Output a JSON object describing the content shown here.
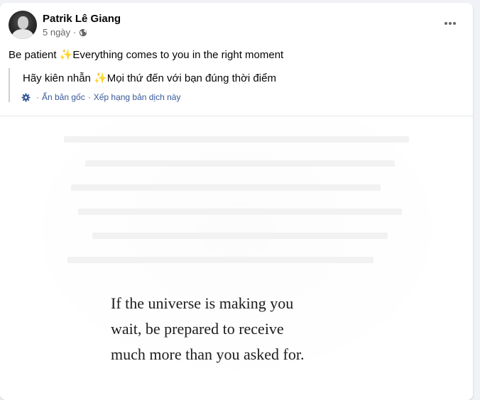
{
  "post": {
    "author": "Patrik Lê Giang",
    "time": "5 ngày",
    "dot": "·",
    "privacy_icon": "globe-icon",
    "more_icon": "more-horizontal-icon",
    "caption": {
      "text": "Be patient ",
      "emoji": "✨",
      "text_after": "Everything comes to you in the right moment"
    },
    "translation": {
      "text": "Hãy kiên nhẫn ",
      "emoji": "✨",
      "text_after": "Mọi thứ đến với bạn đúng thời điểm",
      "settings_icon": "gear-icon",
      "hide_original_label": "Ẩn bản gốc",
      "separator": "·",
      "rate_label": "Xếp hạng bản dịch này"
    },
    "image": {
      "quote_lines": [
        "If the universe is making you",
        "wait, be prepared to receive",
        "much more than you asked for."
      ]
    }
  },
  "colors": {
    "link": "#385898",
    "secondary_text": "#65676b",
    "primary_text": "#050505",
    "page_bg": "#f0f2f5"
  }
}
